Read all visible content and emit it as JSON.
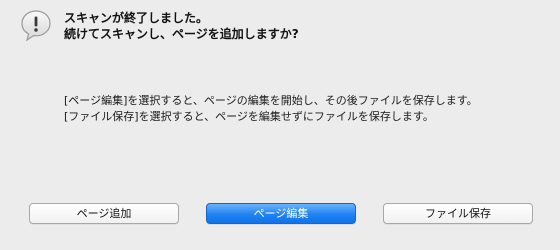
{
  "dialog": {
    "icon": "alert-speech-bubble-icon",
    "title_lines": [
      "スキャンが終了しました。",
      "続けてスキャンし、ページを追加しますか?"
    ],
    "info_lines": [
      "[ページ編集]を選択すると、ページの編集を開始し、その後ファイルを保存します。",
      "[ファイル保存]を選択すると、ページを編集せずにファイルを保存します。"
    ],
    "buttons": {
      "add_page": "ページ追加",
      "edit_page": "ページ編集",
      "save_file": "ファイル保存"
    },
    "colors": {
      "background": "#ececec",
      "default_button": "#1f83f3"
    }
  }
}
